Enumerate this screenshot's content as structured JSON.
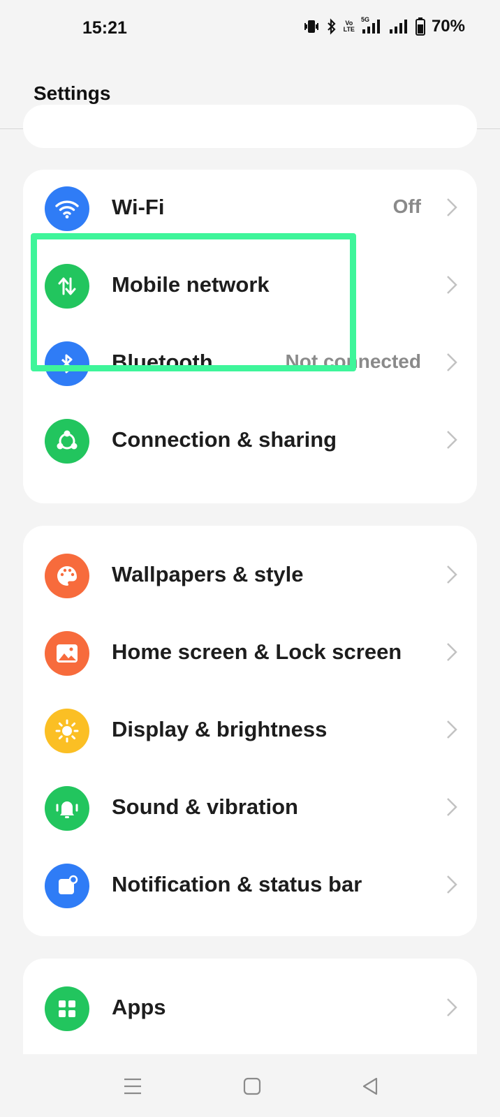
{
  "status_bar": {
    "time": "15:21",
    "volte_top": "Vo",
    "volte_bottom": "LTE",
    "network_5g": "5G",
    "battery": "70%",
    "icons": [
      "vibrate-icon",
      "bluetooth-icon",
      "volte-icon",
      "signal-5g-icon",
      "signal-icon",
      "battery-icon"
    ]
  },
  "header": {
    "title": "Settings"
  },
  "groups": [
    {
      "items": [
        {
          "label": "Wi-Fi",
          "value": "Off",
          "icon": "wifi-icon",
          "color": "#2f7cf6"
        },
        {
          "label": "Mobile network",
          "value": "",
          "icon": "mobile-data-icon",
          "color": "#22c55e"
        },
        {
          "label": "Bluetooth",
          "value": "Not connected",
          "icon": "bluetooth-icon",
          "color": "#2f7cf6"
        },
        {
          "label": "Connection & sharing",
          "value": "",
          "icon": "share-icon",
          "color": "#22c55e"
        }
      ]
    },
    {
      "items": [
        {
          "label": "Wallpapers & style",
          "icon": "palette-icon",
          "color": "#f76b3c"
        },
        {
          "label": "Home screen & Lock screen",
          "icon": "image-icon",
          "color": "#f76b3c"
        },
        {
          "label": "Display & brightness",
          "icon": "sun-icon",
          "color": "#fbbf24"
        },
        {
          "label": "Sound & vibration",
          "icon": "bell-icon",
          "color": "#22c55e"
        },
        {
          "label": "Notification & status bar",
          "icon": "notification-icon",
          "color": "#2f7cf6"
        }
      ]
    },
    {
      "items": [
        {
          "label": "Apps",
          "icon": "apps-grid-icon",
          "color": "#22c55e"
        }
      ]
    }
  ],
  "highlight_color": "#3ef59a",
  "nav": [
    "menu-icon",
    "home-icon",
    "back-icon"
  ]
}
